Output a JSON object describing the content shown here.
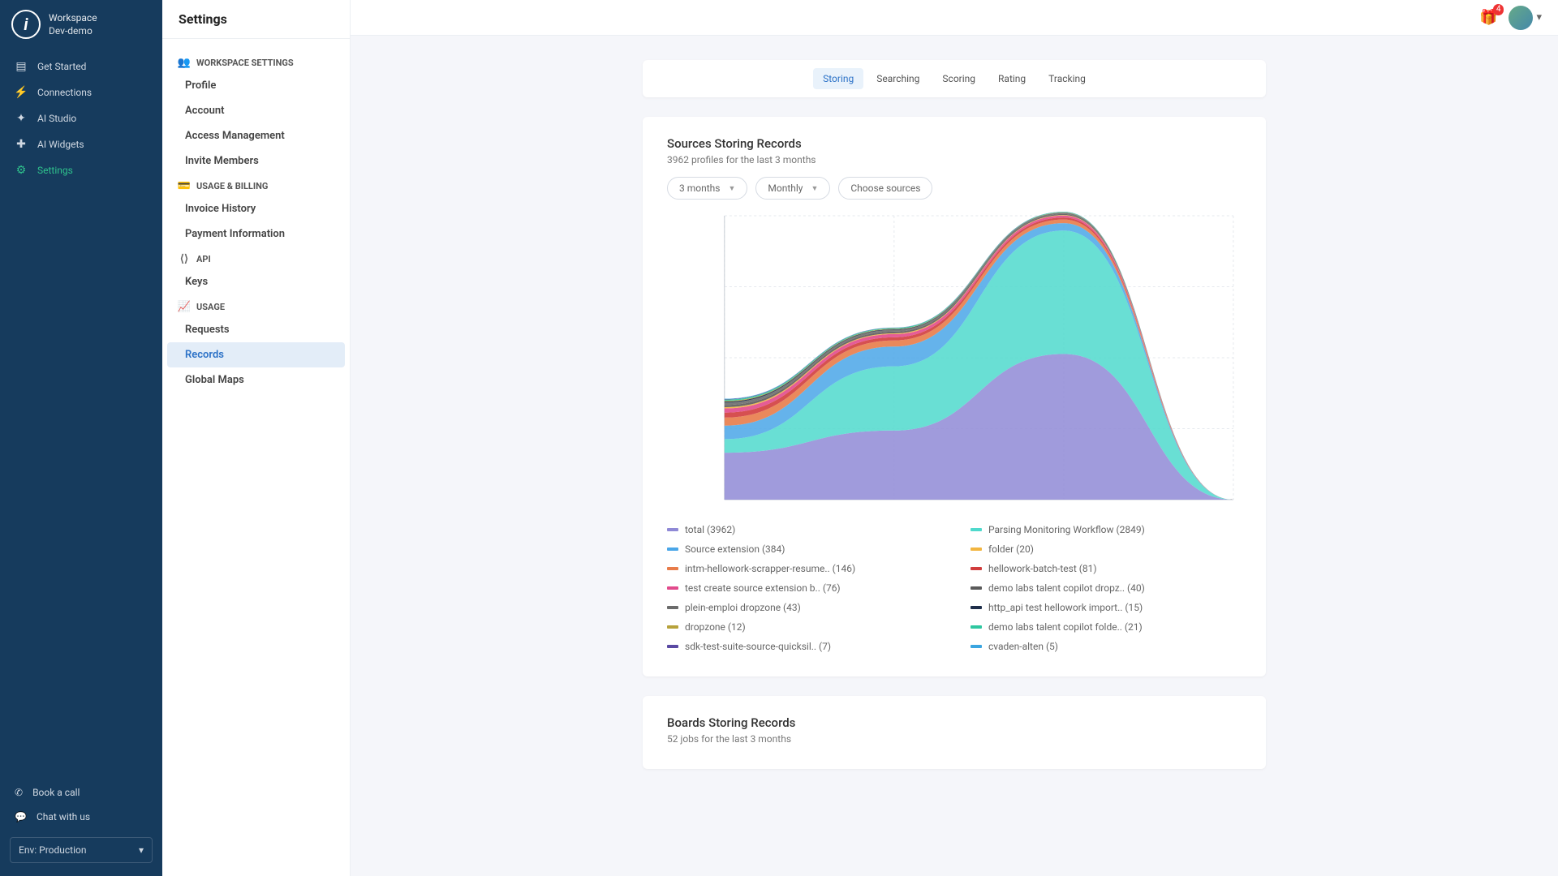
{
  "workspace": {
    "label": "Workspace",
    "name": "Dev-demo"
  },
  "nav": {
    "items": [
      {
        "label": "Get Started"
      },
      {
        "label": "Connections"
      },
      {
        "label": "AI Studio"
      },
      {
        "label": "AI Widgets"
      },
      {
        "label": "Settings"
      }
    ],
    "book_call": "Book a call",
    "chat": "Chat with us",
    "env": "Env: Production"
  },
  "subnav": {
    "title": "Settings",
    "sections": {
      "workspace": {
        "header": "WORKSPACE SETTINGS",
        "items": [
          "Profile",
          "Account",
          "Access Management",
          "Invite Members"
        ]
      },
      "billing": {
        "header": "USAGE & BILLING",
        "items": [
          "Invoice History",
          "Payment Information"
        ]
      },
      "api": {
        "header": "API",
        "items": [
          "Keys"
        ]
      },
      "usage": {
        "header": "USAGE",
        "items": [
          "Requests",
          "Records",
          "Global Maps"
        ]
      }
    }
  },
  "topbar": {
    "badge": "4"
  },
  "tabs": [
    "Storing",
    "Searching",
    "Scoring",
    "Rating",
    "Tracking"
  ],
  "card1": {
    "title": "Sources Storing Records",
    "subtitle": "3962 profiles for the last 3 months",
    "controls": {
      "period": "3 months",
      "granularity": "Monthly",
      "sources": "Choose sources"
    }
  },
  "card2": {
    "title": "Boards Storing Records",
    "subtitle": "52 jobs for the last 3 months"
  },
  "chart_data": {
    "type": "area",
    "title": "Sources Storing Records",
    "xlabel": "",
    "ylabel": "",
    "ylim": [
      0,
      2300
    ],
    "x": [
      0,
      1,
      2,
      3
    ],
    "series": [
      {
        "name": "total (3962)",
        "color": "#8f89d6",
        "values": [
          380,
          560,
          1180,
          0
        ]
      },
      {
        "name": "Parsing Monitoring Workflow (2849)",
        "color": "#4fd9cc",
        "values": [
          110,
          520,
          1000,
          0
        ]
      },
      {
        "name": "Source extension (384)",
        "color": "#4aa6e8",
        "values": [
          110,
          160,
          60,
          0
        ]
      },
      {
        "name": "folder (20)",
        "color": "#f2b540",
        "values": [
          10,
          6,
          4,
          0
        ]
      },
      {
        "name": "intm-hellowork-scrapper-resume.. (146)",
        "color": "#e87c4a",
        "values": [
          65,
          50,
          30,
          0
        ]
      },
      {
        "name": "hellowork-batch-test (81)",
        "color": "#d13d3d",
        "values": [
          40,
          25,
          16,
          0
        ]
      },
      {
        "name": "test create source extension b.. (76)",
        "color": "#e24a8c",
        "values": [
          34,
          26,
          16,
          0
        ]
      },
      {
        "name": "demo labs talent copilot dropz.. (40)",
        "color": "#5a5a5a",
        "values": [
          18,
          14,
          8,
          0
        ]
      },
      {
        "name": "plein-emploi dropzone (43)",
        "color": "#6b6b6b",
        "values": [
          20,
          14,
          9,
          0
        ]
      },
      {
        "name": "http_api test hellowork import.. (15)",
        "color": "#1e2e4a",
        "values": [
          8,
          5,
          2,
          0
        ]
      },
      {
        "name": "dropzone (12)",
        "color": "#b7a23b",
        "values": [
          6,
          4,
          2,
          0
        ]
      },
      {
        "name": "demo labs talent copilot folde.. (21)",
        "color": "#2ec7a0",
        "values": [
          10,
          7,
          4,
          0
        ]
      },
      {
        "name": "sdk-test-suite-source-quicksil.. (7)",
        "color": "#5a4aa3",
        "values": [
          4,
          2,
          1,
          0
        ]
      },
      {
        "name": "cvaden-alten (5)",
        "color": "#3aa5e0",
        "values": [
          3,
          1,
          1,
          0
        ]
      }
    ]
  }
}
